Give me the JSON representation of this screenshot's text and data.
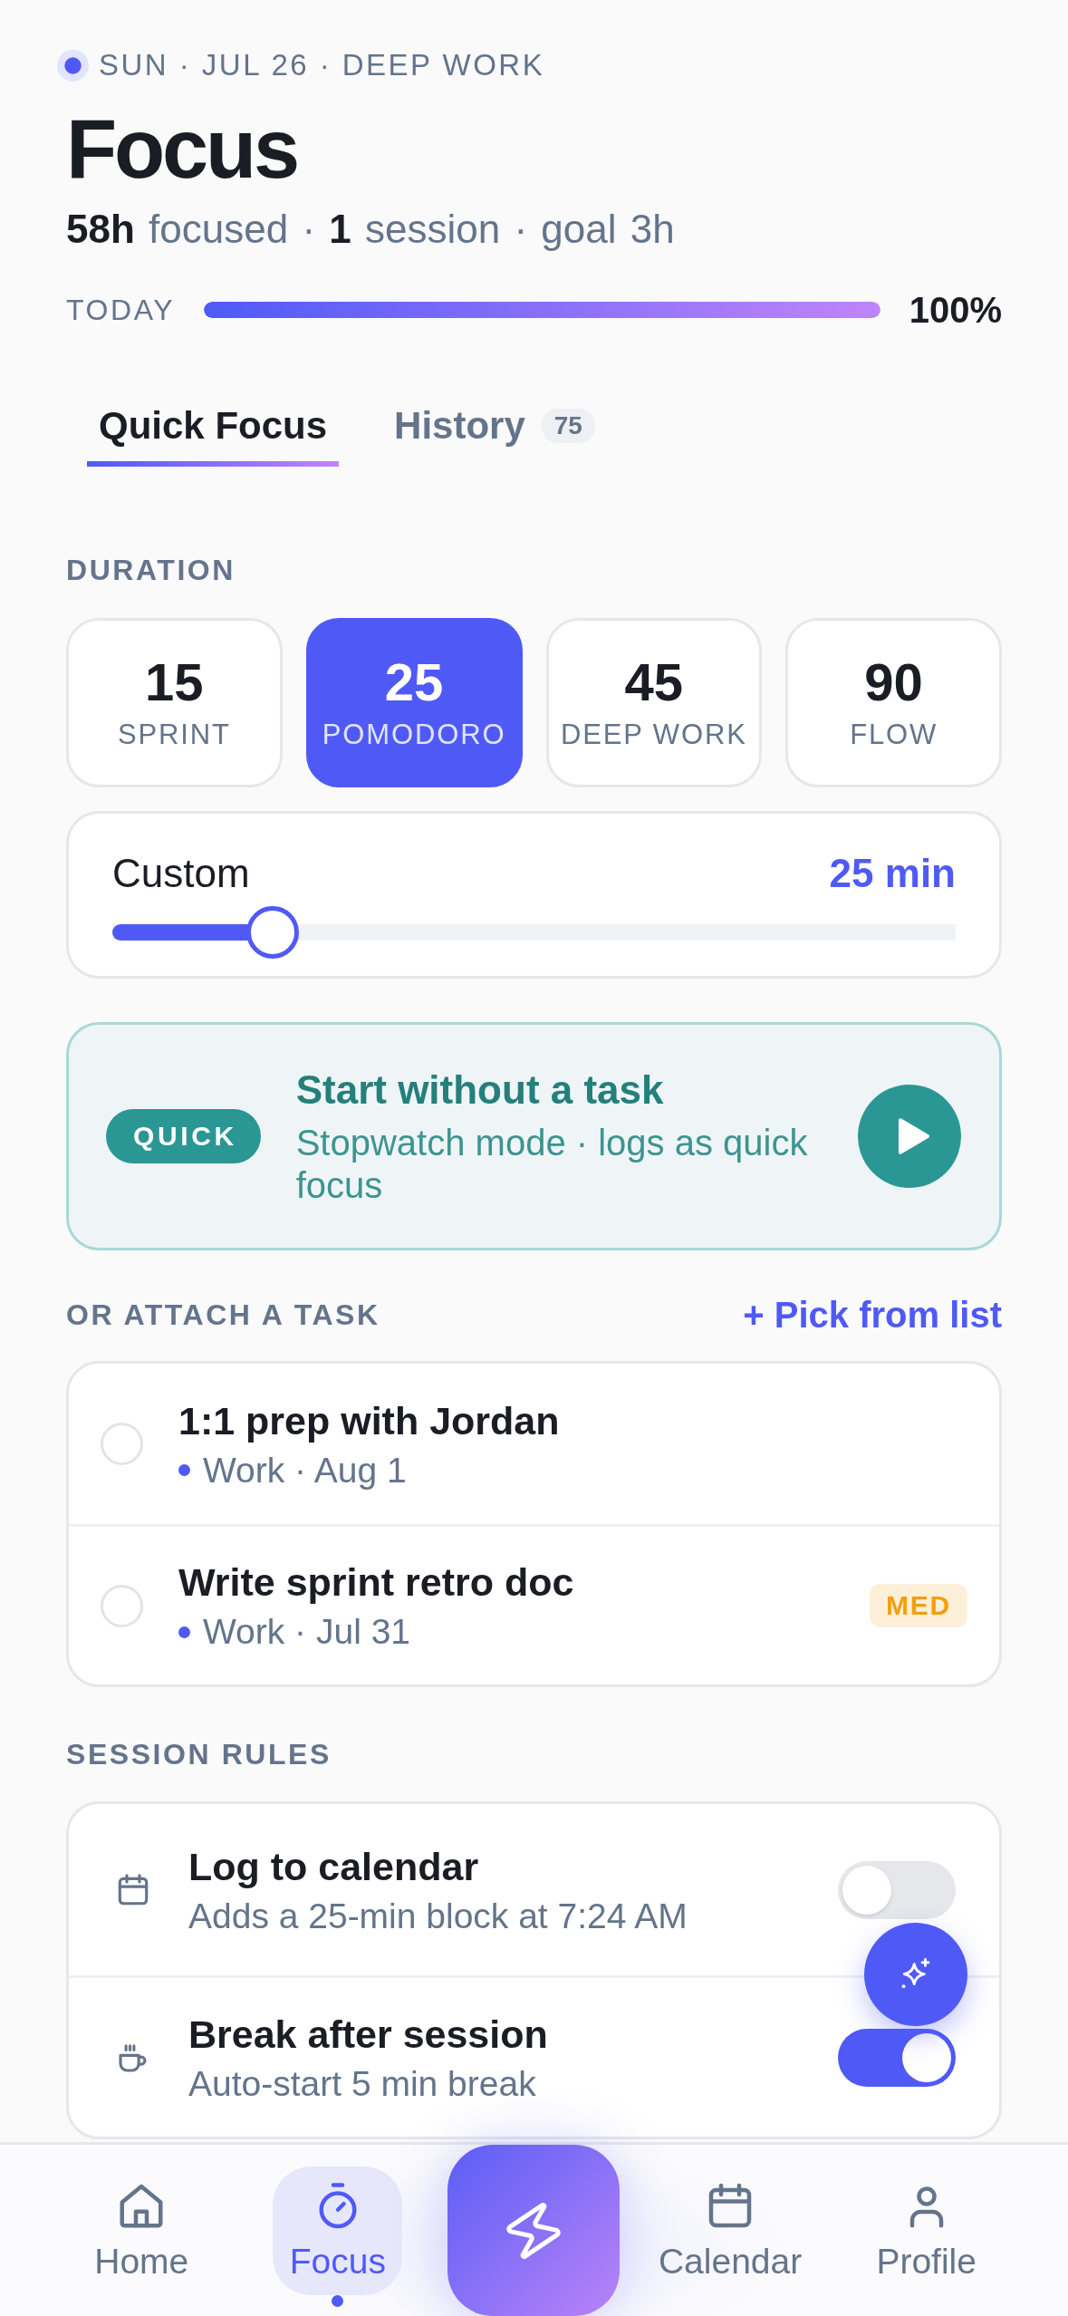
{
  "header": {
    "eyebrow": "SUN · JUL 26 · DEEP WORK",
    "title": "Focus",
    "stats": "**58h** focused · **1** session · goal 3h"
  },
  "today": {
    "label": "TODAY",
    "level": 1,
    "reading": "100%"
  },
  "tabs": [
    {
      "label": "Quick Focus",
      "selected": true
    },
    {
      "label": "History",
      "count": "75",
      "selected": false
    }
  ],
  "duration": {
    "label": "DURATION",
    "presets": [
      {
        "value": "15",
        "label": "SPRINT",
        "selected": false
      },
      {
        "value": "25",
        "label": "POMODORO",
        "selected": true
      },
      {
        "value": "45",
        "label": "DEEP WORK",
        "selected": false
      },
      {
        "value": "90",
        "label": "FLOW",
        "selected": false
      }
    ],
    "custom": {
      "label": "Custom",
      "reading": "25 min",
      "level": 0.19
    }
  },
  "quick_start": {
    "badge": "QUICK",
    "title": "Start without a task",
    "subtitle": "Stopwatch mode · logs as quick focus"
  },
  "tasks": {
    "label": "OR ATTACH A TASK",
    "action": "+ Pick from list",
    "items": [
      {
        "title": "1:1 prep with Jordan",
        "meta": "Work · Aug 1",
        "color": "#5058f6",
        "checked": false
      },
      {
        "title": "Write sprint retro doc",
        "meta": "Work · Jul 31",
        "color": "#5058f6",
        "checked": false,
        "priority": "MED"
      }
    ]
  },
  "session_rules": {
    "label": "SESSION RULES",
    "items": [
      {
        "title": "Log to calendar",
        "subtitle": "Adds a 25-min block at 7:24 AM",
        "on": false
      },
      {
        "title": "Break after session",
        "subtitle": "Auto-start 5 min break",
        "on": true
      }
    ]
  },
  "nav": [
    {
      "kind": "tab",
      "label": "Home",
      "selected": false
    },
    {
      "kind": "tab",
      "label": "Focus",
      "selected": true
    },
    {
      "kind": "action",
      "selected": false
    },
    {
      "kind": "tab",
      "label": "Calendar",
      "selected": false
    },
    {
      "kind": "tab",
      "label": "Profile",
      "selected": false
    }
  ]
}
